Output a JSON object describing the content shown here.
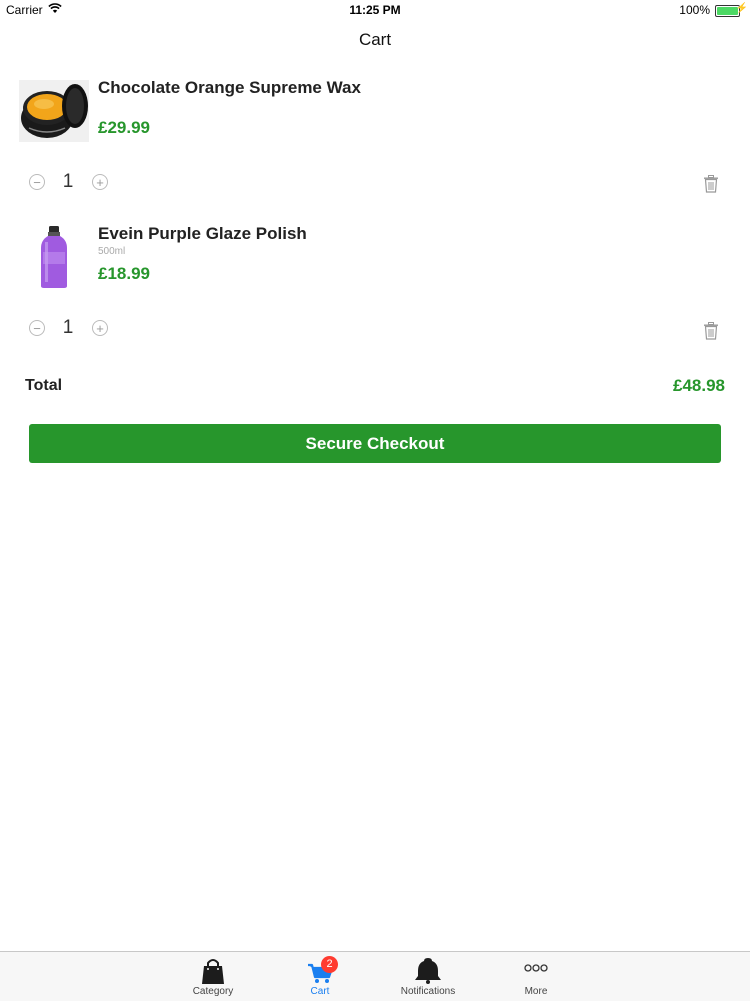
{
  "status_bar": {
    "carrier": "Carrier",
    "time": "11:25 PM",
    "battery": "100%",
    "battery_color": "#4cd964"
  },
  "nav": {
    "title": "Cart"
  },
  "cart": {
    "items": [
      {
        "name": "Chocolate Orange Supreme Wax",
        "variant": "",
        "price": "£29.99",
        "quantity": "1",
        "image_icon": "wax-tin-icon"
      },
      {
        "name": "Evein Purple Glaze Polish",
        "variant": "500ml",
        "price": "£18.99",
        "quantity": "1",
        "image_icon": "purple-bottle-icon"
      }
    ],
    "total_label": "Total",
    "total_value": "£48.98",
    "checkout_label": "Secure Checkout",
    "accent_color": "#27962c"
  },
  "tab_bar": {
    "tabs": [
      {
        "label": "Category",
        "icon": "shopping-bag-icon"
      },
      {
        "label": "Cart",
        "icon": "cart-icon",
        "badge": "2",
        "active": true
      },
      {
        "label": "Notifications",
        "icon": "bell-icon"
      },
      {
        "label": "More",
        "icon": "more-dots-icon"
      }
    ],
    "active_color": "#1a7ff0"
  }
}
